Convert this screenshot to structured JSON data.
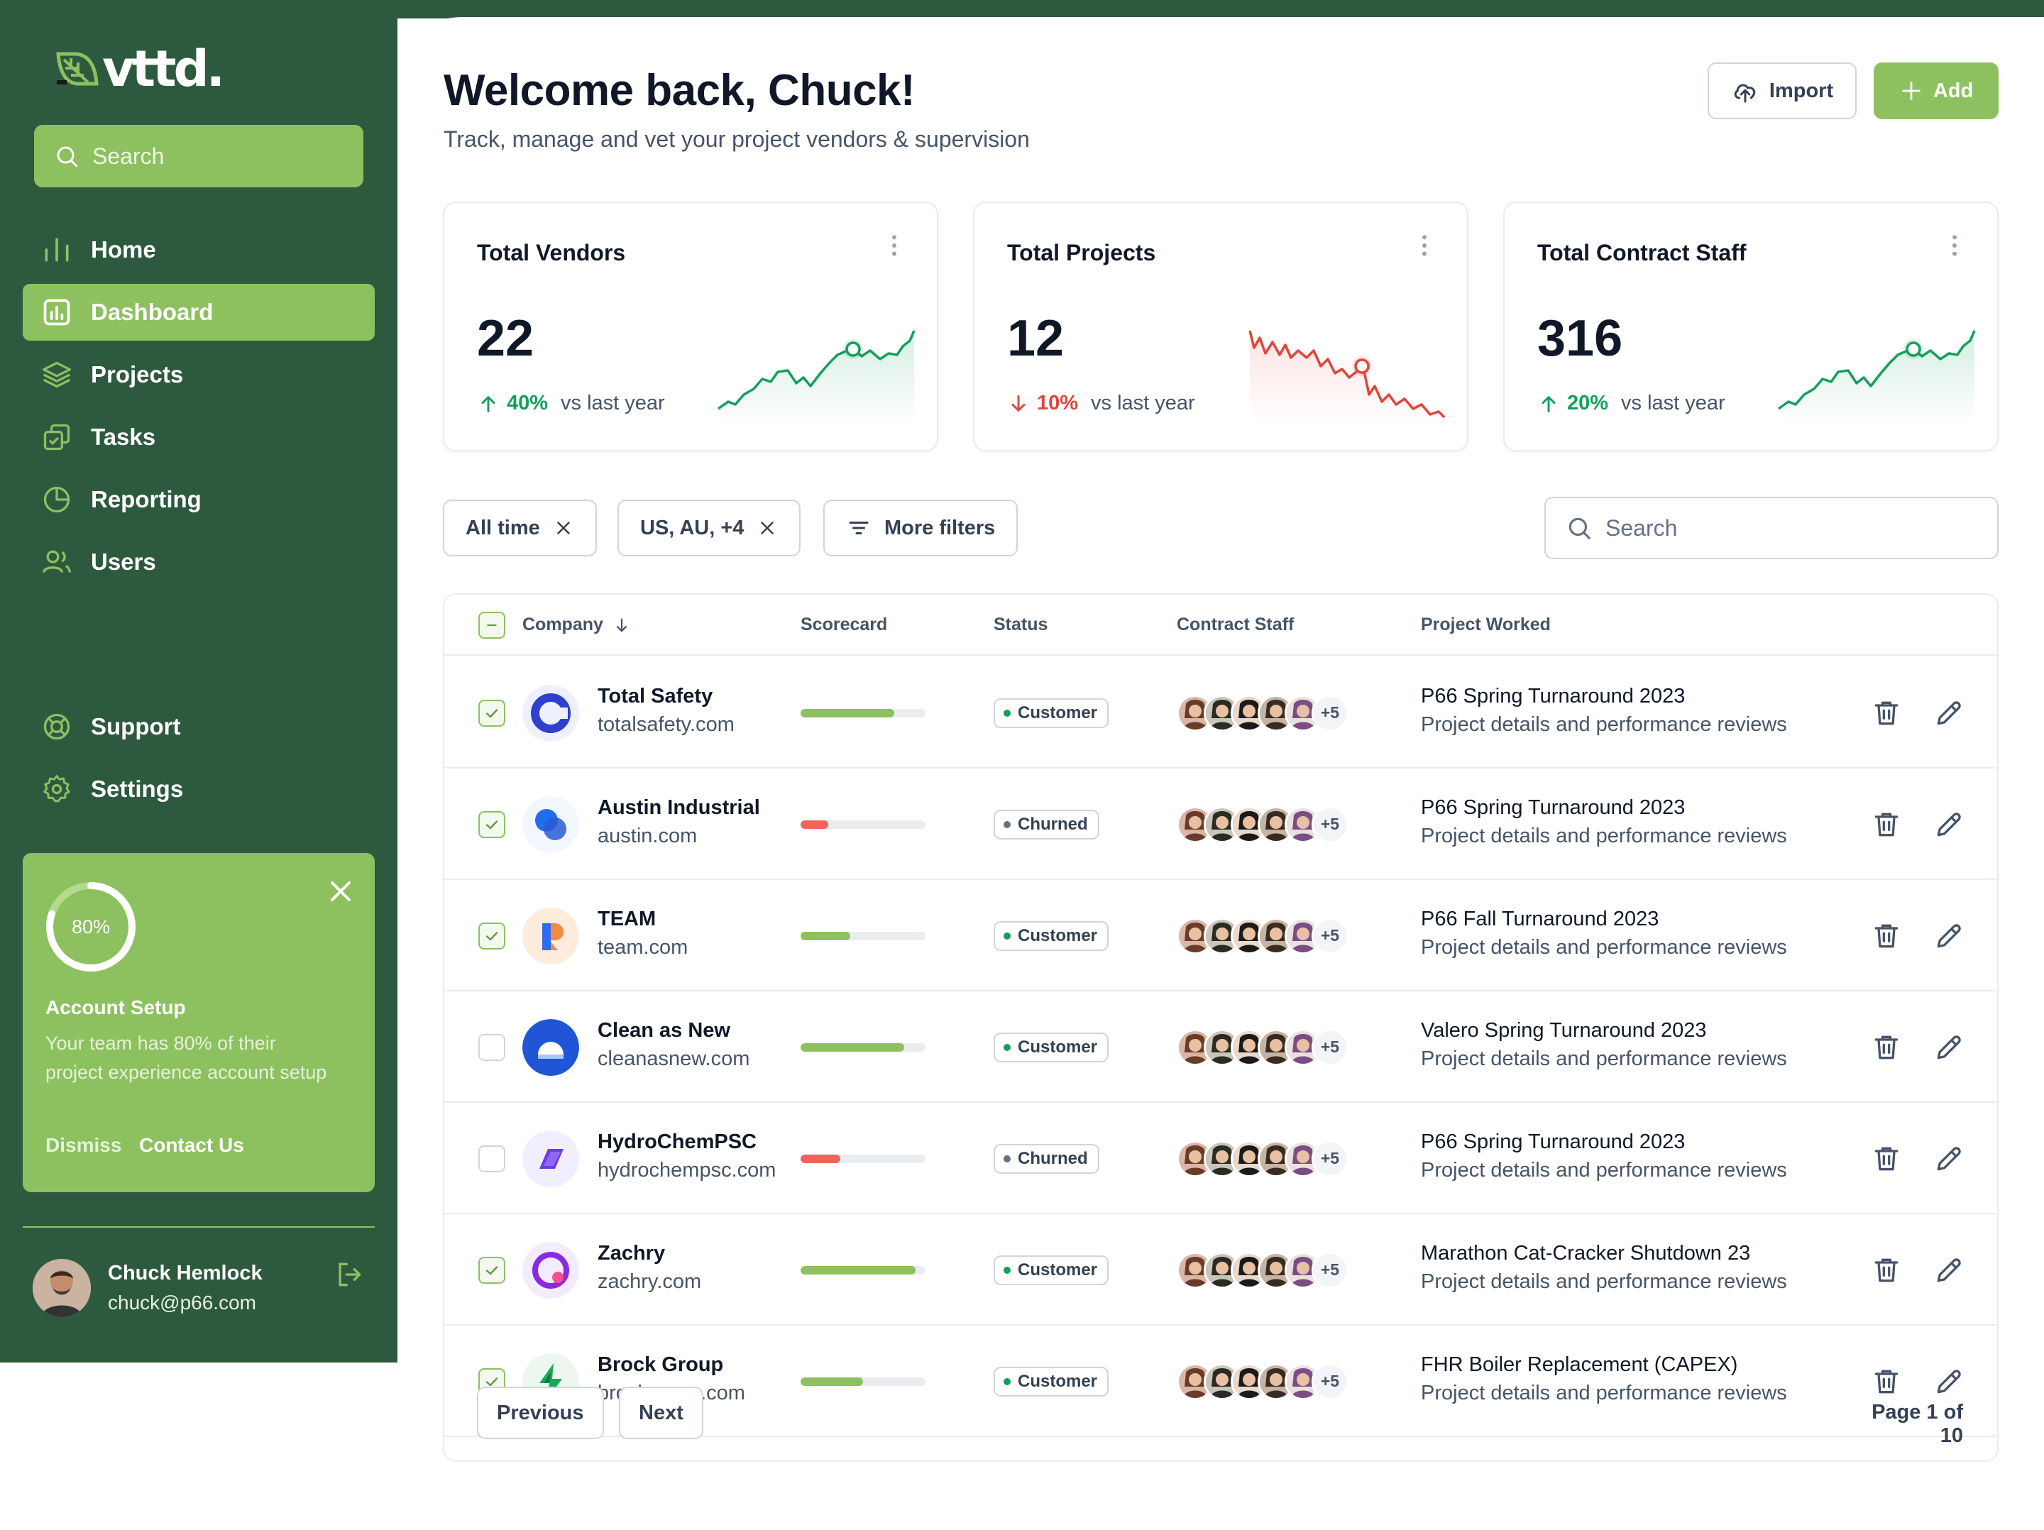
{
  "app": {
    "logo_text": "vttd."
  },
  "sidebar": {
    "search_placeholder": "Search",
    "items": [
      {
        "label": "Home",
        "icon": "bar-chart-icon"
      },
      {
        "label": "Dashboard",
        "icon": "dashboard-icon",
        "active": true
      },
      {
        "label": "Projects",
        "icon": "layers-icon"
      },
      {
        "label": "Tasks",
        "icon": "tasks-icon"
      },
      {
        "label": "Reporting",
        "icon": "pie-chart-icon"
      },
      {
        "label": "Users",
        "icon": "users-icon"
      }
    ],
    "bottom_items": [
      {
        "label": "Support",
        "icon": "life-buoy-icon"
      },
      {
        "label": "Settings",
        "icon": "gear-icon"
      }
    ],
    "setup_card": {
      "progress_label": "80%",
      "progress": 0.8,
      "title": "Account Setup",
      "text": "Your team has 80% of their project experience account setup",
      "dismiss": "Dismiss",
      "contact": "Contact Us"
    },
    "user": {
      "name": "Chuck Hemlock",
      "email": "chuck@p66.com"
    }
  },
  "header": {
    "title": "Welcome back, Chuck!",
    "subtitle": "Track, manage and vet your project vendors & supervision",
    "import_label": "Import",
    "add_label": "Add"
  },
  "stats": [
    {
      "label": "Total Vendors",
      "value": "22",
      "change": "40%",
      "direction": "up",
      "vs": "vs last year",
      "color": "#12a05c"
    },
    {
      "label": "Total Projects",
      "value": "12",
      "change": "10%",
      "direction": "down",
      "vs": "vs last year",
      "color": "#e0453a"
    },
    {
      "label": "Total Contract Staff",
      "value": "316",
      "change": "20%",
      "direction": "up",
      "vs": "vs last year",
      "color": "#12a05c"
    }
  ],
  "filters": {
    "chip1": "All time",
    "chip2": "US, AU, +4",
    "more": "More filters",
    "search_placeholder": "Search"
  },
  "table": {
    "columns": {
      "company": "Company",
      "scorecard": "Scorecard",
      "status": "Status",
      "staff": "Contract Staff",
      "project": "Project Worked"
    },
    "rows": [
      {
        "checked": true,
        "name": "Total Safety",
        "site": "totalsafety.com",
        "score": 0.75,
        "status": "Customer",
        "staff_more": "+5",
        "project": "P66 Spring Turnaround 2023",
        "project_sub": "Project details and performance reviews"
      },
      {
        "checked": true,
        "name": "Austin Industrial",
        "site": "austin.com",
        "score": 0.22,
        "status": "Churned",
        "staff_more": "+5",
        "project": "P66 Spring Turnaround 2023",
        "project_sub": "Project details and performance reviews"
      },
      {
        "checked": true,
        "name": "TEAM",
        "site": "team.com",
        "score": 0.4,
        "status": "Customer",
        "staff_more": "+5",
        "project": "P66 Fall Turnaround 2023",
        "project_sub": "Project details and performance reviews"
      },
      {
        "checked": false,
        "name": "Clean as New",
        "site": "cleanasnew.com",
        "score": 0.83,
        "status": "Customer",
        "staff_more": "+5",
        "project": "Valero Spring Turnaround 2023",
        "project_sub": "Project details and performance reviews"
      },
      {
        "checked": false,
        "name": "HydroChemPSC",
        "site": "hydrochempsc.com",
        "score": 0.32,
        "status": "Churned",
        "staff_more": "+5",
        "project": "P66 Spring Turnaround 2023",
        "project_sub": "Project details and performance reviews"
      },
      {
        "checked": true,
        "name": "Zachry",
        "site": "zachry.com",
        "score": 0.92,
        "status": "Customer",
        "staff_more": "+5",
        "project": "Marathon Cat-Cracker Shutdown 23",
        "project_sub": "Project details and performance reviews"
      },
      {
        "checked": true,
        "name": "Brock Group",
        "site": "brockgroup.com",
        "score": 0.5,
        "status": "Customer",
        "staff_more": "+5",
        "project": "FHR Boiler Replacement (CAPEX)",
        "project_sub": "Project details and performance reviews"
      }
    ]
  },
  "pagination": {
    "previous": "Previous",
    "next": "Next",
    "info": "Page 1 of 10"
  },
  "colors": {
    "sidebar": "#2d5a3f",
    "accent": "#8dc15f",
    "customer_dot": "#12a05c",
    "churned_dot": "#667085",
    "good_bar": "#8dc15f",
    "bad_bar": "#f0645a"
  }
}
